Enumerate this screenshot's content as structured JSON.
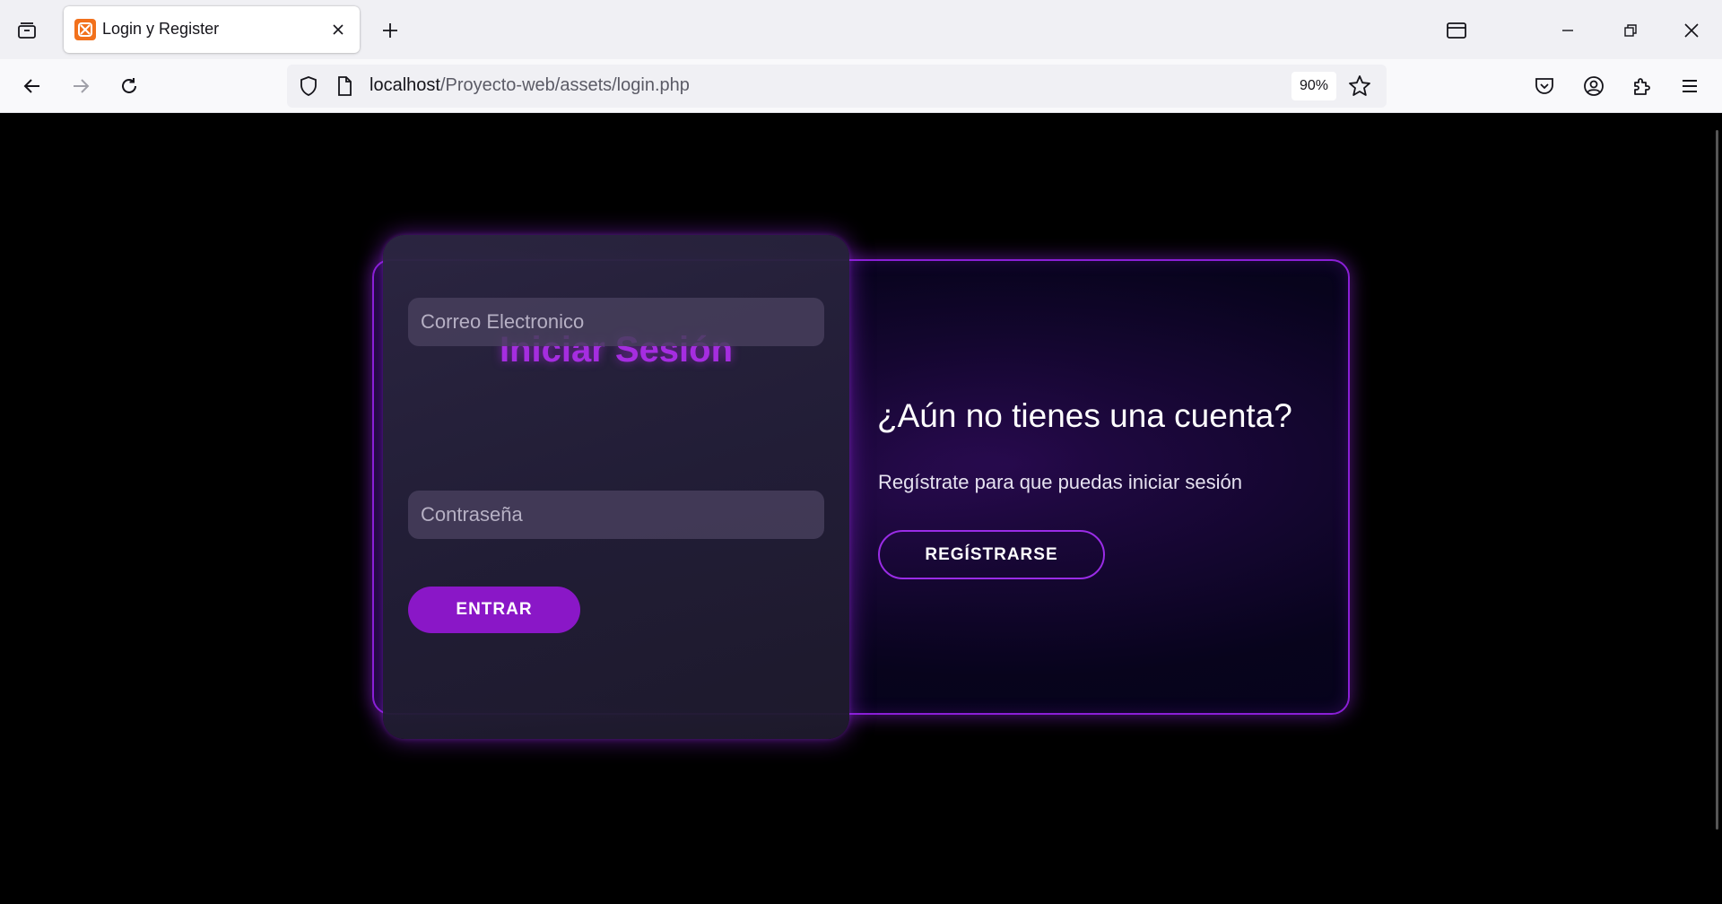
{
  "browser": {
    "tab_title": "Login y Register",
    "url_host": "localhost",
    "url_path": "/Proyecto-web/assets/login.php",
    "zoom": "90%"
  },
  "login": {
    "title": "Iniciar Sesión",
    "email_placeholder": "Correo Electronico",
    "password_placeholder": "Contraseña",
    "enter_label": "ENTRAR"
  },
  "register": {
    "title": "¿Aún no tienes una cuenta?",
    "description": "Regístrate para que puedas iniciar sesión",
    "button_label": "REGÍSTRARSE"
  },
  "colors": {
    "accent": "#8a17c7",
    "title_purple": "#a52de0",
    "border_purple": "#9a2ce6",
    "background": "#000000"
  },
  "icons": {
    "tab_list": "tab-list-icon",
    "favicon": "xampp-favicon-icon",
    "close": "close-icon",
    "new_tab": "plus-icon",
    "back": "back-arrow-icon",
    "forward": "forward-arrow-icon",
    "reload": "reload-icon",
    "shield": "shield-icon",
    "page": "page-icon",
    "star": "star-icon",
    "pocket": "pocket-icon",
    "account": "account-icon",
    "extensions": "extensions-icon",
    "menu": "hamburger-menu-icon"
  }
}
